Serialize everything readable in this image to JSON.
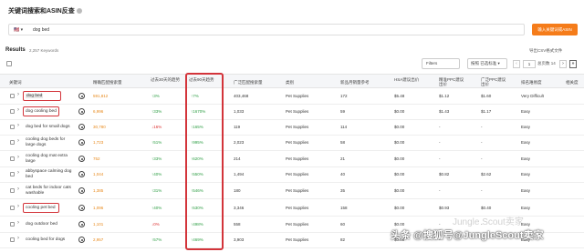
{
  "page": {
    "title": "关键词搜索和ASIN反查"
  },
  "search": {
    "marketplace": "🇺🇸 ▾",
    "query": "dog bed",
    "button": "输入关键词或ASIN"
  },
  "results": {
    "label": "Results",
    "count": "2,257 Keywords",
    "export": "导出CSV格式文件"
  },
  "toolbar": {
    "filters": "Filters",
    "sort": "按照 已选标准 ▾",
    "page_current": "1",
    "page_of": "总页数 14",
    "prev": "‹",
    "next": "›",
    "last": "»"
  },
  "headers": {
    "keyword": "关键词",
    "exact_search": "精确匹配搜索量",
    "trend_30": "过去30天的趋势",
    "trend_90": "过去90天趋势",
    "broad_search": "广泛匹配搜索量",
    "category": "类别",
    "product_ref": "新品月销量参考",
    "hsa": "HSA建议出价",
    "ppc_exact": "精准PPC建议出价",
    "ppc_broad": "广泛PPC建议出价",
    "difficulty": "排名难易度",
    "related": "相关度"
  },
  "rows": [
    {
      "keyword": "dog bed",
      "exact": "591,812",
      "t30": "↑3%",
      "t90": "↑7%",
      "broad": "403,468",
      "category": "Pet Supplies",
      "ref": "172",
      "hsa": "$5.48",
      "ppc_exact": "$1.12",
      "ppc_broad": "$1.60",
      "difficulty": "Very Difficult"
    },
    {
      "keyword": "dog cooling bed",
      "exact": "6,996",
      "t30": "↑33%",
      "t90": "↑1670%",
      "broad": "1,033",
      "category": "Pet Supplies",
      "ref": "59",
      "hsa": "$0.00",
      "ppc_exact": "$1.43",
      "ppc_broad": "$1.17",
      "difficulty": "Easy"
    },
    {
      "keyword": "dog bed for small dogs",
      "exact": "30,780",
      "t30": "↓16%",
      "t90": "↑165%",
      "broad": "119",
      "category": "Pet Supplies",
      "ref": "114",
      "hsa": "$0.00",
      "ppc_exact": "-",
      "ppc_broad": "-",
      "difficulty": "Easy"
    },
    {
      "keyword": "cooling dog beds for large dogs",
      "exact": "1,723",
      "t30": "↑51%",
      "t90": "↑995%",
      "broad": "2,023",
      "category": "Pet Supplies",
      "ref": "58",
      "hsa": "$0.00",
      "ppc_exact": "-",
      "ppc_broad": "-",
      "difficulty": "Easy"
    },
    {
      "keyword": "cooling dog mat extra large",
      "exact": "752",
      "t30": "↑33%",
      "t90": "↑620%",
      "broad": "214",
      "category": "Pet Supplies",
      "ref": "21",
      "hsa": "$0.00",
      "ppc_exact": "-",
      "ppc_broad": "-",
      "difficulty": "Easy"
    },
    {
      "keyword": "abbyspace calming dog bed",
      "exact": "1,044",
      "t30": "↑40%",
      "t90": "↑550%",
      "broad": "1,494",
      "category": "Pet Supplies",
      "ref": "40",
      "hsa": "$0.00",
      "ppc_exact": "$0.82",
      "ppc_broad": "$2.62",
      "difficulty": "Easy"
    },
    {
      "keyword": "cat beds for indoor cats washable",
      "exact": "1,385",
      "t30": "↑31%",
      "t90": "↑546%",
      "broad": "180",
      "category": "Pet Supplies",
      "ref": "35",
      "hsa": "$0.00",
      "ppc_exact": "-",
      "ppc_broad": "-",
      "difficulty": "Easy"
    },
    {
      "keyword": "cooling pet bed",
      "exact": "1,096",
      "t30": "↑40%",
      "t90": "↑530%",
      "broad": "3,346",
      "category": "Pet Supplies",
      "ref": "158",
      "hsa": "$0.00",
      "ppc_exact": "$0.93",
      "ppc_broad": "$0.40",
      "difficulty": "Easy"
    },
    {
      "keyword": "dog outdoor bed",
      "exact": "1,101",
      "t30": "↓0%",
      "t90": "↑498%",
      "broad": "558",
      "category": "Pet Supplies",
      "ref": "60",
      "hsa": "$0.00",
      "ppc_exact": "-",
      "ppc_broad": "-",
      "difficulty": "Easy"
    },
    {
      "keyword": "cooling bed for dogs",
      "exact": "2,957",
      "t30": "↑57%",
      "t90": "↑469%",
      "broad": "3,903",
      "category": "Pet Supplies",
      "ref": "82",
      "hsa": "$0.00",
      "ppc_exact": "-",
      "ppc_broad": "-",
      "difficulty": "Easy"
    }
  ],
  "watermark": {
    "text": "头条 @搜狐号@JungleScout卖家",
    "faint": "Jungle Scout卖家"
  },
  "colors": {
    "accent": "#f57c1a",
    "highlight": "#d3343a",
    "up": "#2e9e44",
    "down": "#dd3333"
  }
}
